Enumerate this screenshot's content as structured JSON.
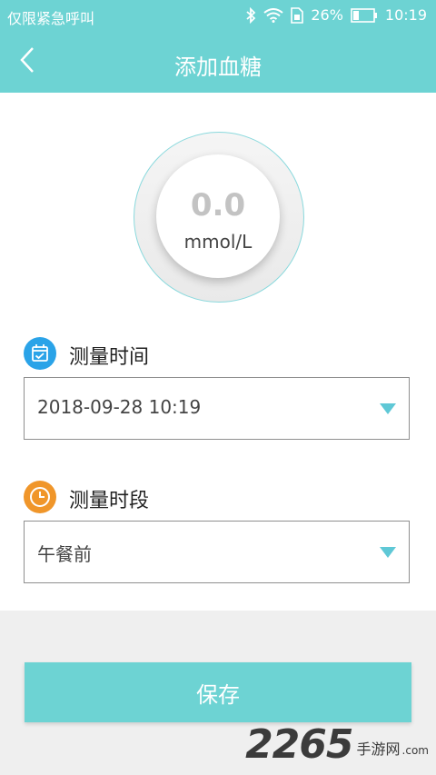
{
  "status_bar": {
    "carrier_text": "仅限紧急呼叫",
    "battery_percent": "26%",
    "time": "10:19",
    "icons": [
      "bluetooth-icon",
      "wifi-icon",
      "sim-icon",
      "battery-icon"
    ]
  },
  "app_bar": {
    "title": "添加血糖",
    "back_icon": "chevron-left-icon"
  },
  "reading": {
    "value": "0.0",
    "unit": "mmol/L"
  },
  "measure_time": {
    "label": "测量时间",
    "icon": "calendar-icon",
    "icon_color": "#2aa3e8",
    "value": "2018-09-28 10:19"
  },
  "measure_period": {
    "label": "测量时段",
    "icon": "clock-icon",
    "icon_color": "#f0962a",
    "value": "午餐前"
  },
  "save_button": {
    "label": "保存"
  },
  "watermark": {
    "number": "2265",
    "text": "手游网",
    "domain": ".com"
  },
  "colors": {
    "accent": "#6dd3d3",
    "arrow": "#5fc8d6"
  }
}
